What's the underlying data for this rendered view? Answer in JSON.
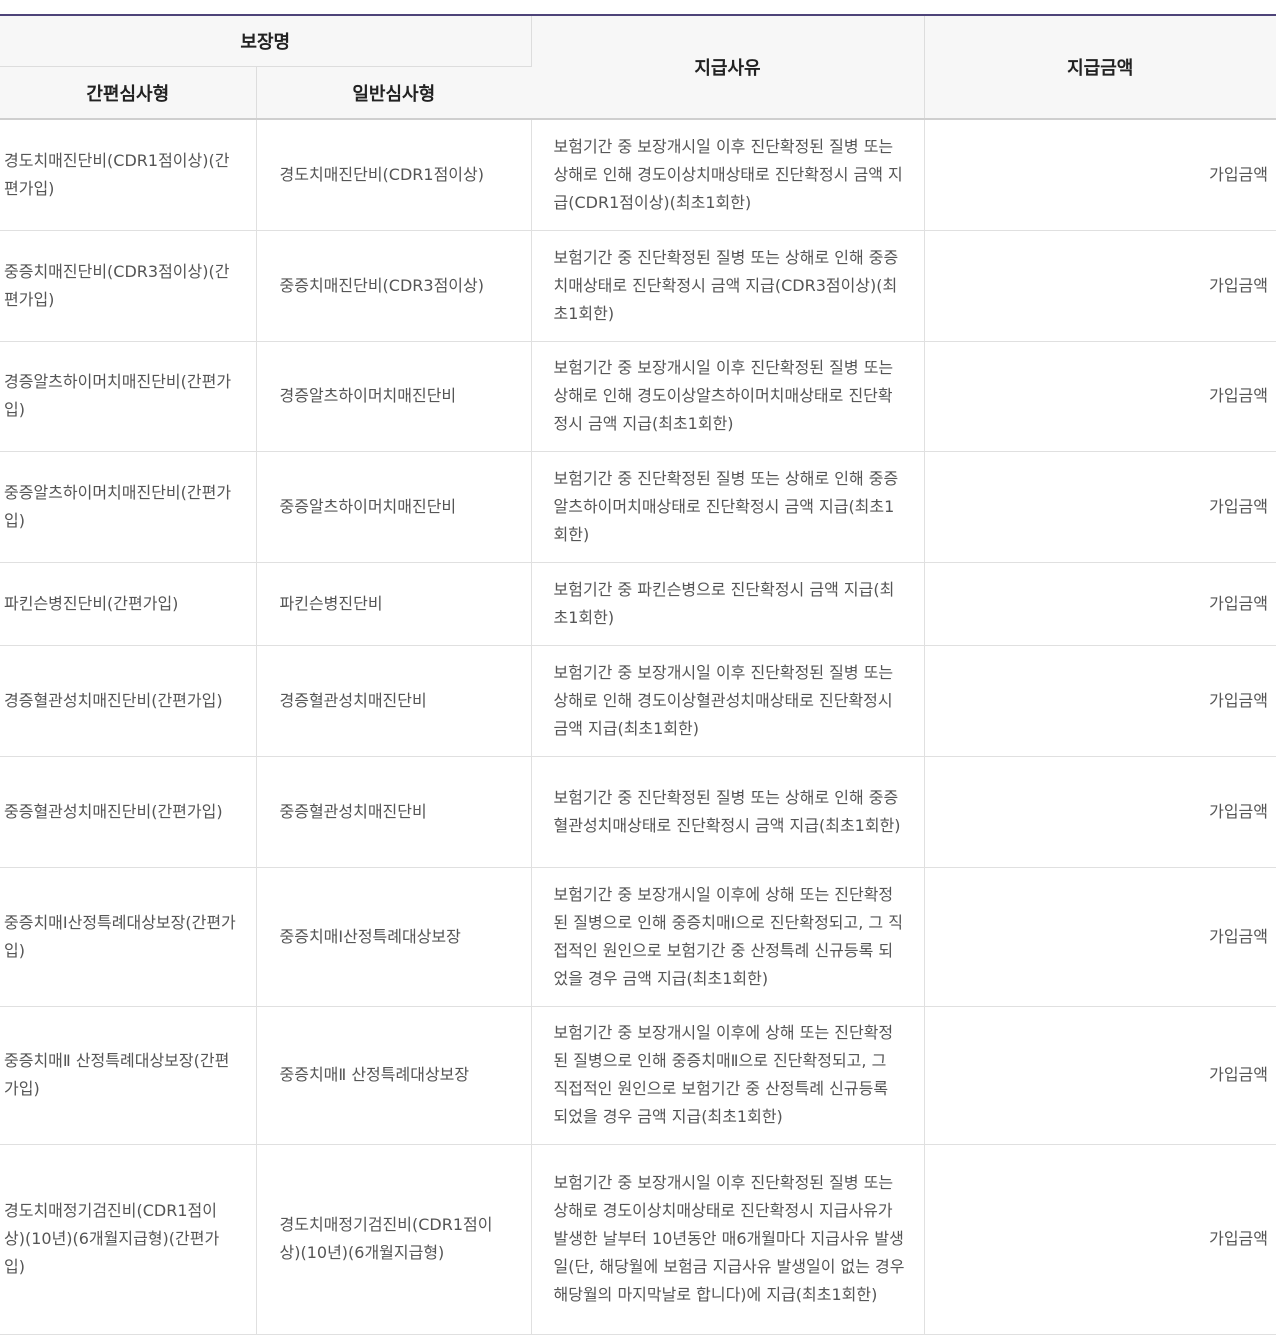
{
  "table": {
    "headers": {
      "coverage_name": "보장명",
      "simplified": "간편심사형",
      "general": "일반심사형",
      "reason": "지급사유",
      "amount": "지급금액"
    },
    "rows": [
      {
        "simplified": "경도치매진단비(CDR1점이상)(간편가입)",
        "general": "경도치매진단비(CDR1점이상)",
        "reason": "보험기간 중 보장개시일 이후 진단확정된 질병 또는 상해로 인해 경도이상치매상태로 진단확정시 금액 지급(CDR1점이상)(최초1회한)",
        "amount": "가입금액"
      },
      {
        "simplified": "중증치매진단비(CDR3점이상)(간편가입)",
        "general": "중증치매진단비(CDR3점이상)",
        "reason": "보험기간 중 진단확정된 질병 또는 상해로 인해 중증치매상태로 진단확정시 금액 지급(CDR3점이상)(최초1회한)",
        "amount": "가입금액"
      },
      {
        "simplified": "경증알츠하이머치매진단비(간편가입)",
        "general": "경증알츠하이머치매진단비",
        "reason": "보험기간 중 보장개시일 이후 진단확정된 질병 또는 상해로 인해 경도이상알츠하이머치매상태로 진단확정시 금액 지급(최초1회한)",
        "amount": "가입금액"
      },
      {
        "simplified": "중증알츠하이머치매진단비(간편가입)",
        "general": "중증알츠하이머치매진단비",
        "reason": "보험기간 중 진단확정된 질병 또는 상해로 인해 중증알츠하이머치매상태로 진단확정시 금액 지급(최초1회한)",
        "amount": "가입금액"
      },
      {
        "simplified": "파킨슨병진단비(간편가입)",
        "general": "파킨슨병진단비",
        "reason": "보험기간 중 파킨슨병으로 진단확정시 금액 지급(최초1회한)",
        "amount": "가입금액"
      },
      {
        "simplified": "경증혈관성치매진단비(간편가입)",
        "general": "경증혈관성치매진단비",
        "reason": "보험기간 중 보장개시일 이후 진단확정된 질병 또는 상해로 인해 경도이상혈관성치매상태로 진단확정시 금액 지급(최초1회한)",
        "amount": "가입금액"
      },
      {
        "simplified": "중증혈관성치매진단비(간편가입)",
        "general": "중증혈관성치매진단비",
        "reason": "보험기간 중 진단확정된 질병 또는 상해로 인해 중증혈관성치매상태로 진단확정시 금액 지급(최초1회한)",
        "amount": "가입금액"
      },
      {
        "simplified": "중증치매Ⅰ산정특례대상보장(간편가입)",
        "general": "중증치매Ⅰ산정특례대상보장",
        "reason": "보험기간 중 보장개시일 이후에 상해 또는 진단확정된 질병으로 인해 중증치매Ⅰ으로 진단확정되고, 그 직접적인 원인으로 보험기간 중 산정특례 신규등록 되었을 경우 금액 지급(최초1회한)",
        "amount": "가입금액"
      },
      {
        "simplified": "중증치매Ⅱ 산정특례대상보장(간편가입)",
        "general": "중증치매Ⅱ 산정특례대상보장",
        "reason": "보험기간 중 보장개시일 이후에 상해 또는 진단확정된 질병으로 인해 중증치매Ⅱ으로 진단확정되고, 그 직접적인 원인으로 보험기간 중 산정특례 신규등록 되었을 경우 금액 지급(최초1회한)",
        "amount": "가입금액"
      },
      {
        "simplified": "경도치매정기검진비(CDR1점이상)(10년)(6개월지급형)(간편가입)",
        "general": "경도치매정기검진비(CDR1점이상)(10년)(6개월지급형)",
        "reason": "보험기간 중 보장개시일 이후 진단확정된 질병 또는 상해로 경도이상치매상태로 진단확정시 지급사유가 발생한 날부터 10년동안 매6개월마다 지급사유 발생일(단, 해당월에 보험금 지급사유 발생일이 없는 경우 해당월의 마지막날로 합니다)에 지급(최초1회한)",
        "amount": "가입금액"
      }
    ]
  }
}
